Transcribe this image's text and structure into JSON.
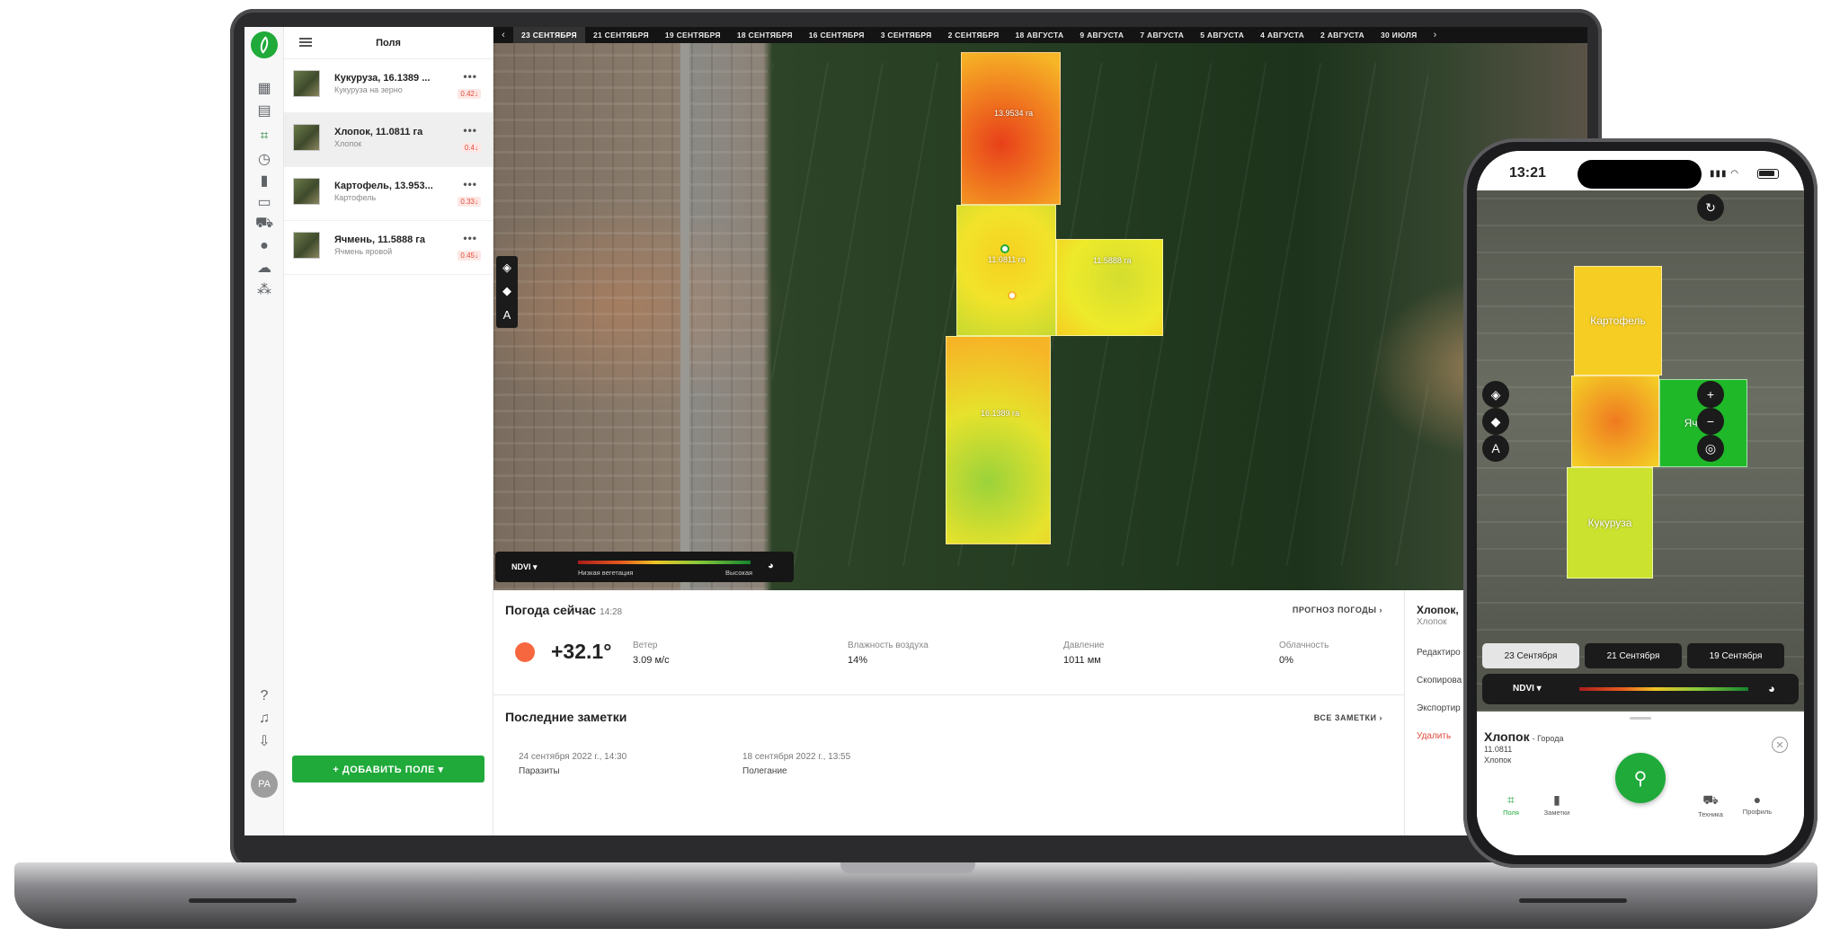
{
  "app": {
    "list_title": "Поля",
    "add_field_label": "+ ДОБАВИТЬ ПОЛЕ ▾",
    "user_initials": "PA",
    "fields": [
      {
        "name": "Кукуруза, 16.1389 ...",
        "crop": "Кукуруза на зерно",
        "badge": "0.42↓"
      },
      {
        "name": "Хлопок, 11.0811 га",
        "crop": "Хлопок",
        "badge": "0.4↓"
      },
      {
        "name": "Картофель, 13.953...",
        "crop": "Картофель",
        "badge": "0.33↓"
      },
      {
        "name": "Ячмень, 11.5888 га",
        "crop": "Ячмень яровой",
        "badge": "0.45↓"
      }
    ]
  },
  "map": {
    "dates": [
      "23 СЕНТЯБРЯ",
      "21 СЕНТЯБРЯ",
      "19 СЕНТЯБРЯ",
      "18 СЕНТЯБРЯ",
      "16 СЕНТЯБРЯ",
      "3 СЕНТЯБРЯ",
      "2 СЕНТЯБРЯ",
      "18 АВГУСТА",
      "9 АВГУСТА",
      "7 АВГУСТА",
      "5 АВГУСТА",
      "4 АВГУСТА",
      "2 АВГУСТА",
      "30 ИЮЛЯ"
    ],
    "active_date": "23 СЕНТЯБРЯ",
    "field_areas": {
      "top": "13.9534 га",
      "center": "11.0811 га",
      "right": "11.5888 га",
      "bottom": "16.1389 га"
    },
    "layer_select": "NDVI ▾",
    "legend_low": "Низкая вегетация",
    "legend_high": "Высокая",
    "tool_letter": "A"
  },
  "weather": {
    "title": "Погода сейчас",
    "time": "14:28",
    "forecast_link": "ПРОГНОЗ ПОГОДЫ ›",
    "temperature": "+32.1°",
    "metrics": [
      {
        "label": "Ветер",
        "value": "3.09 м/с"
      },
      {
        "label": "Влажность воздуха",
        "value": "14%"
      },
      {
        "label": "Давление",
        "value": "1011 мм"
      },
      {
        "label": "Облачность",
        "value": "0%"
      }
    ]
  },
  "notes": {
    "title": "Последние заметки",
    "all_link": "ВСЕ ЗАМЕТКИ ›",
    "items": [
      {
        "date": "24 сентября 2022 г., 14:30",
        "text": "Паразиты"
      },
      {
        "date": "18 сентября 2022 г., 13:55",
        "text": "Полегание"
      }
    ]
  },
  "side_panel": {
    "title": "Хлопок,",
    "subtitle": "Хлопок",
    "actions": [
      "Редактиро",
      "Скопирова",
      "Экспортир",
      "Удалить"
    ]
  },
  "phone": {
    "time": "13:21",
    "fields": {
      "potato": "Картофель",
      "barley": "Ячмень",
      "corn": "Кукуруза"
    },
    "dates": [
      "23 Сентября",
      "21 Сентября",
      "19 Сентября"
    ],
    "layer_select": "NDVI ▾",
    "sheet": {
      "name": "Хлопок",
      "suffix": "- Города",
      "area": "11.0811",
      "crop": "Хлопок"
    },
    "tool_letter": "A",
    "nav": [
      "Поля",
      "Заметки",
      "Техника",
      "Профиль"
    ]
  },
  "colors": {
    "brand_green": "#1faa3a",
    "alert_red": "#e24b3b",
    "sun_orange": "#f6673f"
  },
  "icons": [
    "leaf-icon",
    "building-icon",
    "calendar-icon",
    "fields-icon",
    "clock-icon",
    "notes-icon",
    "devices-icon",
    "tractor-icon",
    "user-icon",
    "cloud-icon",
    "team-icon",
    "help-icon",
    "bell-icon",
    "download-icon",
    "layers-icon",
    "fill-icon",
    "palette-icon",
    "sync-icon",
    "plus-icon",
    "minus-icon",
    "locate-icon",
    "location-pin-icon",
    "close-icon"
  ]
}
